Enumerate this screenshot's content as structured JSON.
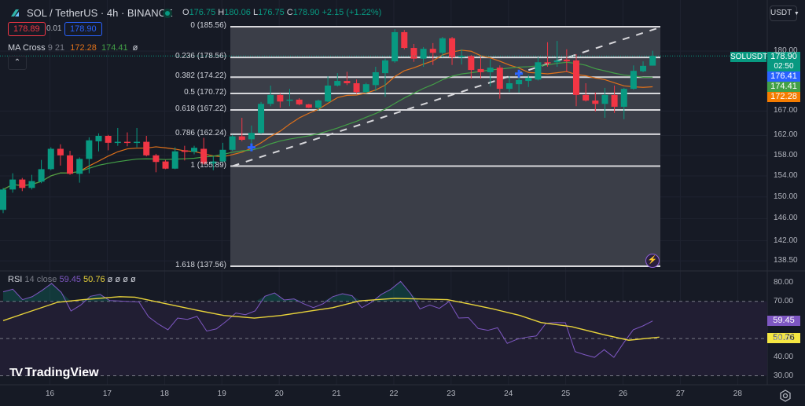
{
  "header": {
    "symbol_title": "SOL / TetherUS · 4h · BINANCE",
    "ohlc": {
      "o_label": "O",
      "o": "176.75",
      "h_label": "H",
      "h": "180.06",
      "l_label": "L",
      "l": "176.75",
      "c_label": "C",
      "c": "178.90",
      "change": "+2.15 (+1.22%)"
    },
    "bid": "178.89",
    "spread": "0.01",
    "ask": "178.90",
    "currency_button": "USDT"
  },
  "indicators": {
    "ma_cross": {
      "name": "MA Cross",
      "params": "9 21",
      "ma9": "172.28",
      "ma21": "174.41",
      "flag": "ø"
    },
    "rsi": {
      "name": "RSI",
      "params": "14 close",
      "value": "59.45",
      "ma": "50.76",
      "flags": "ø ø ø ø"
    }
  },
  "price_labels": {
    "symbol": "SOLUSDT",
    "last": "178.90",
    "countdown": "02:50",
    "blue": "176.41",
    "ma21": "174.41",
    "ma9": "172.28",
    "rsi": "59.45",
    "rsi_ma": "50.76"
  },
  "colors": {
    "up": "#089981",
    "down": "#f23645",
    "ma9": "#e0711a",
    "ma21": "#43a047",
    "rsi": "#7e57c2",
    "rsi_ma": "#e8d33a",
    "blue": "#2962ff"
  },
  "brand": "TradingView",
  "chart_data": {
    "type": "candlestick",
    "scale": "log",
    "candles": [
      [
        147.6,
        151.7,
        147.0,
        151.4
      ],
      [
        151.4,
        154.5,
        150.8,
        153.3
      ],
      [
        153.3,
        153.6,
        151.1,
        151.7
      ],
      [
        151.7,
        154.2,
        151.4,
        153.0
      ],
      [
        152.9,
        157.1,
        152.6,
        155.3
      ],
      [
        155.3,
        159.6,
        155.1,
        159.3
      ],
      [
        159.3,
        160.2,
        156.0,
        158.0
      ],
      [
        158.0,
        158.9,
        154.2,
        154.4
      ],
      [
        154.4,
        157.6,
        152.7,
        157.3
      ],
      [
        157.3,
        161.6,
        154.5,
        161.0
      ],
      [
        160.8,
        162.4,
        158.8,
        161.9
      ],
      [
        161.9,
        162.1,
        159.0,
        160.5
      ],
      [
        160.5,
        163.5,
        159.9,
        160.7
      ],
      [
        160.7,
        162.6,
        159.8,
        160.5
      ],
      [
        160.5,
        163.5,
        159.6,
        160.7
      ],
      [
        160.7,
        161.9,
        157.8,
        158.0
      ],
      [
        158.0,
        158.3,
        154.7,
        156.7
      ],
      [
        156.8,
        157.1,
        155.3,
        155.4
      ],
      [
        155.4,
        159.6,
        155.3,
        158.8
      ],
      [
        159.0,
        159.9,
        157.0,
        158.7
      ],
      [
        158.7,
        159.9,
        158.2,
        159.5
      ],
      [
        159.3,
        161.5,
        156.2,
        156.4
      ],
      [
        156.4,
        157.8,
        155.1,
        156.8
      ],
      [
        156.8,
        160.5,
        156.7,
        159.1
      ],
      [
        159.1,
        162.1,
        158.9,
        161.8
      ],
      [
        161.8,
        165.6,
        160.8,
        161.1
      ],
      [
        161.2,
        164.0,
        160.3,
        162.5
      ],
      [
        162.5,
        168.9,
        162.3,
        168.5
      ],
      [
        168.5,
        172.4,
        168.0,
        170.4
      ],
      [
        170.4,
        170.7,
        167.7,
        169.0
      ],
      [
        169.2,
        171.7,
        168.0,
        169.4
      ],
      [
        169.4,
        169.7,
        168.2,
        168.4
      ],
      [
        168.4,
        168.5,
        167.6,
        167.7
      ],
      [
        167.7,
        169.4,
        167.1,
        169.2
      ],
      [
        169.0,
        174.4,
        168.9,
        172.4
      ],
      [
        172.4,
        175.1,
        172.2,
        173.4
      ],
      [
        173.4,
        175.4,
        172.5,
        172.9
      ],
      [
        172.9,
        173.7,
        170.7,
        171.0
      ],
      [
        171.0,
        173.0,
        170.7,
        172.7
      ],
      [
        172.5,
        176.5,
        171.2,
        175.3
      ],
      [
        175.1,
        178.3,
        170.0,
        177.9
      ],
      [
        177.7,
        185.0,
        177.4,
        184.3
      ],
      [
        184.3,
        184.8,
        180.4,
        180.7
      ],
      [
        180.7,
        181.6,
        177.6,
        178.3
      ],
      [
        178.3,
        180.9,
        176.5,
        180.5
      ],
      [
        180.5,
        181.8,
        176.9,
        179.6
      ],
      [
        179.6,
        183.2,
        178.6,
        182.9
      ],
      [
        182.9,
        183.2,
        176.9,
        178.6
      ],
      [
        178.6,
        180.4,
        177.0,
        178.9
      ],
      [
        178.9,
        179.1,
        173.9,
        175.8
      ],
      [
        176.0,
        178.6,
        173.9,
        175.3
      ],
      [
        175.3,
        178.2,
        172.2,
        176.3
      ],
      [
        176.3,
        176.8,
        169.6,
        171.7
      ],
      [
        171.7,
        174.4,
        171.0,
        172.9
      ],
      [
        172.7,
        174.4,
        170.9,
        173.6
      ],
      [
        173.4,
        174.7,
        172.1,
        174.1
      ],
      [
        173.7,
        178.6,
        173.5,
        177.5
      ],
      [
        177.5,
        182.0,
        176.5,
        177.4
      ],
      [
        177.5,
        182.3,
        176.5,
        177.9
      ],
      [
        178.1,
        180.4,
        175.3,
        177.7
      ],
      [
        177.9,
        179.3,
        168.0,
        170.4
      ],
      [
        170.4,
        172.9,
        169.0,
        169.2
      ],
      [
        169.2,
        170.9,
        166.9,
        168.5
      ],
      [
        168.5,
        171.9,
        165.6,
        170.4
      ],
      [
        170.4,
        172.4,
        166.6,
        167.9
      ],
      [
        167.9,
        171.9,
        165.3,
        171.7
      ],
      [
        171.7,
        176.8,
        171.5,
        175.6
      ],
      [
        175.5,
        177.7,
        175.3,
        176.7
      ],
      [
        176.75,
        180.06,
        176.75,
        178.9
      ]
    ],
    "ma_periods": [
      9,
      21
    ],
    "fib_levels": [
      {
        "ratio": "0",
        "price": 185.56,
        "label": "0 (185.56)"
      },
      {
        "ratio": "0.236",
        "price": 178.56,
        "label": "0.236 (178.56)"
      },
      {
        "ratio": "0.382",
        "price": 174.22,
        "label": "0.382 (174.22)"
      },
      {
        "ratio": "0.5",
        "price": 170.72,
        "label": "0.5 (170.72)"
      },
      {
        "ratio": "0.618",
        "price": 167.22,
        "label": "0.618 (167.22)"
      },
      {
        "ratio": "0.786",
        "price": 162.24,
        "label": "0.786 (162.24)"
      },
      {
        "ratio": "1",
        "price": 155.89,
        "label": "1 (155.89)"
      },
      {
        "ratio": "1.618",
        "price": 137.56,
        "label": "1.618 (137.56)"
      }
    ],
    "trend_line": {
      "from": [
        24,
        155.89
      ],
      "to": [
        69,
        185.56
      ]
    },
    "markers": [
      [
        26,
        159.6
      ],
      [
        54,
        175.0
      ]
    ],
    "price_ticks": [
      180,
      167,
      162,
      158,
      154,
      150,
      146,
      142,
      138.5
    ],
    "price_tick_labels": [
      "180.00",
      "167.00",
      "162.00",
      "158.00",
      "154.00",
      "150.00",
      "146.00",
      "142.00",
      "138.50"
    ],
    "rsi": [
      75.1,
      76.5,
      70.9,
      72.5,
      75.8,
      79.6,
      74.8,
      64.8,
      68.0,
      72.7,
      73.7,
      70.4,
      70.2,
      69.9,
      69.7,
      61.7,
      57.8,
      54.7,
      61.0,
      60.3,
      61.9,
      54.0,
      55.2,
      59.2,
      63.7,
      62.8,
      64.9,
      72.7,
      74.5,
      70.7,
      71.3,
      68.7,
      66.6,
      68.7,
      72.5,
      74.1,
      73.0,
      66.6,
      69.5,
      73.7,
      76.5,
      80.7,
      74.4,
      65.9,
      68.0,
      66.2,
      69.9,
      61.0,
      61.2,
      55.4,
      54.4,
      55.8,
      47.4,
      49.6,
      50.7,
      51.4,
      58.2,
      58.6,
      58.5,
      43.0,
      41.3,
      39.9,
      44.0,
      39.9,
      47.6,
      54.7,
      56.8,
      59.45
    ],
    "rsi_ma": [
      [
        0,
        59.6
      ],
      [
        2.4,
        63.8
      ],
      [
        5.7,
        69.5
      ],
      [
        8.4,
        70.9
      ],
      [
        12.2,
        72.5
      ],
      [
        13.8,
        72.2
      ],
      [
        17.7,
        68.0
      ],
      [
        20.3,
        65.2
      ],
      [
        23.1,
        62.4
      ],
      [
        26.3,
        61.0
      ],
      [
        29.1,
        62.4
      ],
      [
        31.8,
        64.5
      ],
      [
        34.5,
        66.6
      ],
      [
        37.3,
        70.2
      ],
      [
        41,
        71.6
      ],
      [
        46.5,
        70.9
      ],
      [
        48.7,
        68.7
      ],
      [
        51.3,
        65.9
      ],
      [
        54.1,
        62.4
      ],
      [
        56.3,
        58.6
      ],
      [
        59.5,
        56.4
      ],
      [
        62.8,
        52.2
      ],
      [
        65.5,
        49.1
      ],
      [
        68.7,
        50.76
      ]
    ],
    "rsi_ticks": [
      80,
      70,
      50,
      40,
      30
    ],
    "rsi_tick_labels": [
      "80.00",
      "70.00",
      "50.00",
      "40.00",
      "30.00"
    ],
    "rsi_bands": [
      70,
      50,
      30
    ],
    "x_labels": [
      "16",
      "17",
      "18",
      "19",
      "20",
      "21",
      "22",
      "23",
      "24",
      "25",
      "26",
      "27",
      "28"
    ],
    "first_label_bar": 4.9
  }
}
